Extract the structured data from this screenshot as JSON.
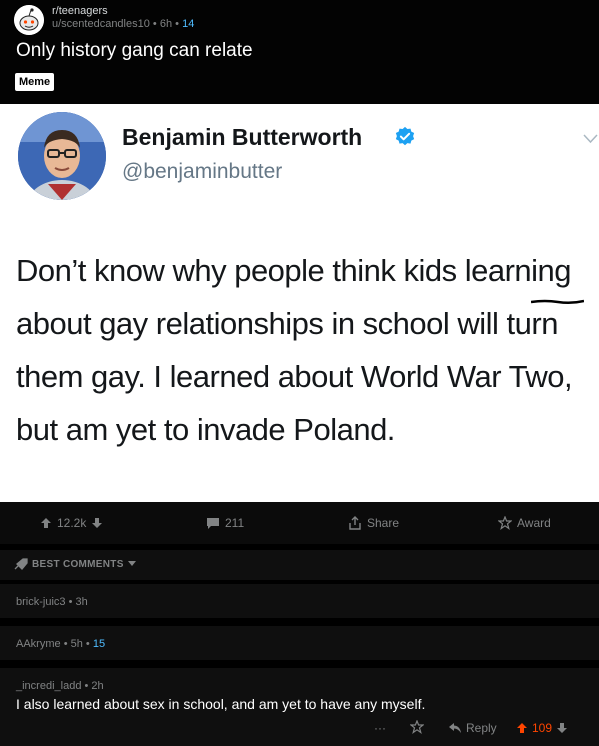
{
  "post": {
    "subreddit": "r/teenagers",
    "author": "u/scentedcandles10",
    "age": "6h",
    "points": "14",
    "title": "Only history gang can relate",
    "flair": "Meme"
  },
  "tweet": {
    "name": "Benjamin Butterworth",
    "handle": "@benjaminbutter",
    "text": "Don’t know why people think kids learning about gay relationships in school will turn them gay. I learned about World War Two, but am yet to invade Poland."
  },
  "actions": {
    "upvotes": "12.2k",
    "comments": "211",
    "share": "Share",
    "award": "Award"
  },
  "comments_header": "BEST COMMENTS",
  "comments": [
    {
      "author": "brick-juic3",
      "age": "3h",
      "points": "",
      "body": ""
    },
    {
      "author": "AAkryme",
      "age": "5h",
      "points": "15",
      "body": ""
    },
    {
      "author": "_incredi_ladd",
      "age": "2h",
      "points": "",
      "body": "I also learned about sex in school, and am yet to have any myself."
    }
  ],
  "comment_actions": {
    "more": "···",
    "reply": "Reply",
    "votes": "109"
  },
  "colors": {
    "upvote": "#ff4500",
    "points": "#4fbcff",
    "verified": "#1da1f2"
  }
}
